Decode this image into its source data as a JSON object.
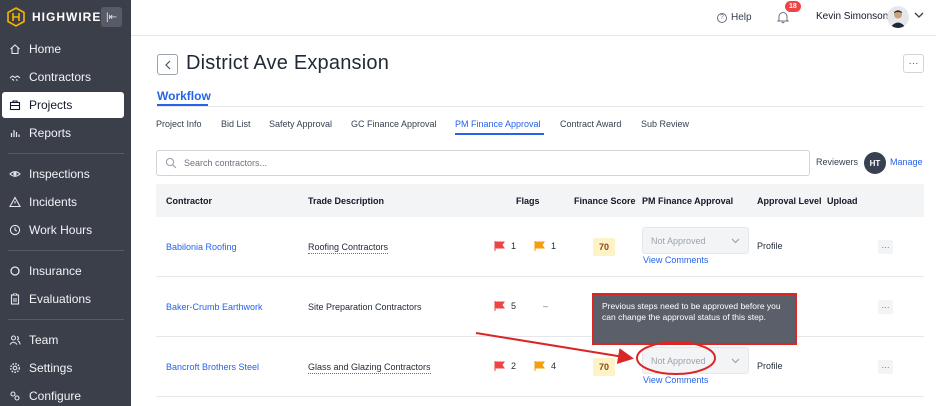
{
  "brand": {
    "name": "HIGHWIRE",
    "collapse_icon": "collapse-left-icon"
  },
  "sidebar": {
    "items": [
      {
        "label": "Home",
        "icon": "home-icon"
      },
      {
        "label": "Contractors",
        "icon": "contractors-icon"
      },
      {
        "label": "Projects",
        "icon": "projects-icon",
        "active": true
      },
      {
        "label": "Reports",
        "icon": "reports-icon"
      },
      {
        "label": "Inspections",
        "icon": "eye-icon"
      },
      {
        "label": "Incidents",
        "icon": "warning-icon"
      },
      {
        "label": "Work Hours",
        "icon": "clock-icon"
      },
      {
        "label": "Insurance",
        "icon": "circle-icon"
      },
      {
        "label": "Evaluations",
        "icon": "clipboard-icon"
      },
      {
        "label": "Team",
        "icon": "team-icon"
      },
      {
        "label": "Settings",
        "icon": "gear-icon"
      },
      {
        "label": "Configure",
        "icon": "configure-icon"
      }
    ]
  },
  "topbar": {
    "help_label": "Help",
    "notification_count": "18",
    "user_name": "Kevin Simonson"
  },
  "header": {
    "title": "District Ave Expansion",
    "workflow_tab": "Workflow",
    "steps": [
      "Project Info",
      "Bid List",
      "Safety Approval",
      "GC Finance Approval",
      "PM Finance Approval",
      "Contract Award",
      "Sub Review"
    ],
    "active_step": "PM Finance Approval"
  },
  "search": {
    "placeholder": "Search contractors..."
  },
  "reviewers": {
    "label": "Reviewers",
    "badge": "HT",
    "manage_label": "Manage"
  },
  "table": {
    "columns": [
      "Contractor",
      "Trade Description",
      "Flags",
      "Finance Score",
      "PM Finance Approval",
      "Approval Level",
      "Upload"
    ],
    "rows": [
      {
        "contractor": "Babilonia Roofing",
        "trade": "Roofing Contractors",
        "red_flags": "1",
        "yellow_flags": "1",
        "score": "70",
        "approval": "Not Approved",
        "view_comments": "View Comments",
        "level": "Profile"
      },
      {
        "contractor": "Baker-Crumb Earthwork",
        "trade": "Site Preparation Contractors",
        "red_flags": "5",
        "yellow_flags": "–",
        "score": "",
        "approval": "",
        "view_comments": "",
        "level": ""
      },
      {
        "contractor": "Bancroft Brothers Steel",
        "trade": "Glass and Glazing Contractors",
        "red_flags": "2",
        "yellow_flags": "4",
        "score": "70",
        "approval": "Not Approved",
        "view_comments": "View Comments",
        "level": "Profile"
      }
    ]
  },
  "tooltip": {
    "text": "Previous steps need to be approved before you can change the approval status of this step."
  },
  "colors": {
    "accent": "#2563eb",
    "sidebar": "#3b3f4a",
    "annotation_red": "#dc2626",
    "flag_red": "#ef4444",
    "flag_yellow": "#f59e0b"
  }
}
